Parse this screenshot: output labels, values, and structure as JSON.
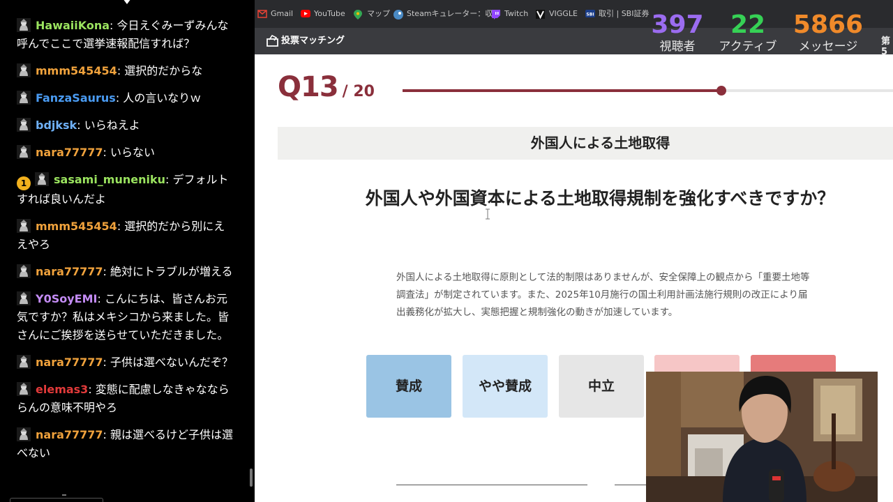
{
  "chat": {
    "messages": [
      {
        "user": "HawaiiKona",
        "color": "#9be45f",
        "text": "今日えぐみーずみんな呼んでここで選挙速報配信すれば？",
        "badge": ""
      },
      {
        "user": "mmm545454",
        "color": "#f0a23c",
        "text": "選択的だからな",
        "badge": ""
      },
      {
        "user": "FanzaSaurus",
        "color": "#4a9bf2",
        "text": "人の言いなりｗ",
        "badge": ""
      },
      {
        "user": "bdjksk",
        "color": "#6fb1f7",
        "text": "いらねえよ",
        "badge": ""
      },
      {
        "user": "nara77777",
        "color": "#f0a23c",
        "text": "いらない",
        "badge": ""
      },
      {
        "user": "sasami_muneniku",
        "color": "#9be45f",
        "text": "デフォルトすれば良いんだよ",
        "badge": "1"
      },
      {
        "user": "mmm545454",
        "color": "#f0a23c",
        "text": "選択的だから別にええやろ",
        "badge": ""
      },
      {
        "user": "nara77777",
        "color": "#f0a23c",
        "text": "絶対にトラブルが増える",
        "badge": ""
      },
      {
        "user": "Y0SoyEMI",
        "color": "#c48cf5",
        "text": "こんにちは、皆さんお元気ですか？私はメキシコから来ました。皆さんにご挨拶を送らせていただきました。",
        "badge": ""
      },
      {
        "user": "nara77777",
        "color": "#f0a23c",
        "text": "子供は選べないんだぞ？",
        "badge": ""
      },
      {
        "user": "elemas3",
        "color": "#e23a3a",
        "text": "変態に配慮しなきゃななららんの意味不明やろ",
        "badge": ""
      },
      {
        "user": "nara77777",
        "color": "#f0a23c",
        "text": "親は選べるけど子供は選べない",
        "badge": ""
      }
    ]
  },
  "bookmarks": [
    {
      "label": "Gmail",
      "icon": "gmail-icon"
    },
    {
      "label": "YouTube",
      "icon": "youtube-icon"
    },
    {
      "label": "マップ",
      "icon": "maps-icon"
    },
    {
      "label": "Steamキュレーター：収...",
      "icon": "steam-icon"
    },
    {
      "label": "Twitch",
      "icon": "twitch-icon"
    },
    {
      "label": "VIGGLE",
      "icon": "viggle-icon"
    },
    {
      "label": "取引 | SBI証券",
      "icon": "sbi-icon"
    }
  ],
  "site": {
    "logo": "投票マッチング"
  },
  "stats": [
    {
      "value": "397",
      "label": "視聴者",
      "color": "#9b6cf0"
    },
    {
      "value": "22",
      "label": "アクティブ",
      "color": "#36d155"
    },
    {
      "value": "5866",
      "label": "メッセージ",
      "color": "#f08a2a"
    }
  ],
  "stats_extra": "第5",
  "quiz": {
    "qnum": "Q13",
    "total": "/ 20",
    "progress": 0.65,
    "topic": "外国人による土地取得",
    "question": "外国人や外国資本による土地取得規制を強化すべきですか？",
    "description": "外国人による土地取得に原則として法的制限はありませんが、安全保障上の観点から「重要土地等調査法」が制定されています。また、2025年10月施行の国土利用計画法施行規則の改正により届出義務化が拡大し、実態把握と規制強化の動きが加速しています。",
    "options": [
      "賛成",
      "やや賛成",
      "中立",
      "",
      ""
    ]
  }
}
